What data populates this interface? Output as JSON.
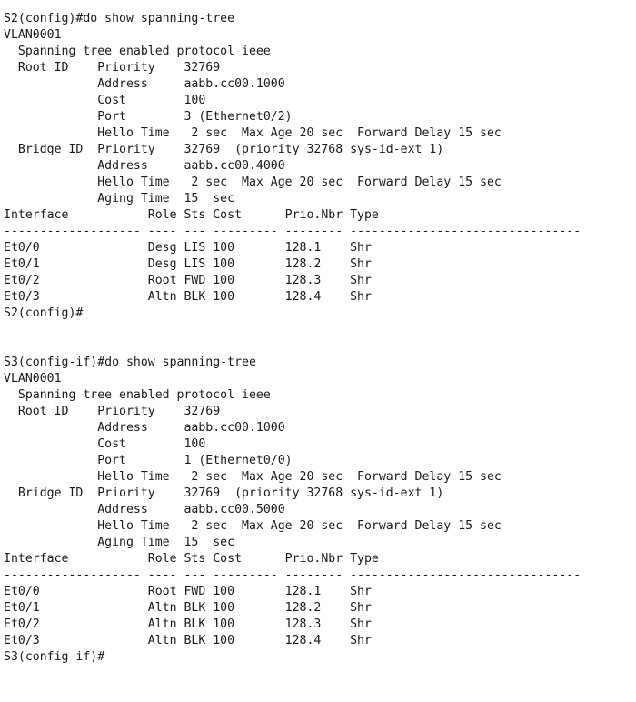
{
  "terminal": {
    "lines": [
      "S2(config)#do show spanning-tree",
      "VLAN0001",
      "  Spanning tree enabled protocol ieee",
      "  Root ID    Priority    32769",
      "             Address     aabb.cc00.1000",
      "             Cost        100",
      "             Port        3 (Ethernet0/2)",
      "             Hello Time   2 sec  Max Age 20 sec  Forward Delay 15 sec",
      "  Bridge ID  Priority    32769  (priority 32768 sys-id-ext 1)",
      "             Address     aabb.cc00.4000",
      "             Hello Time   2 sec  Max Age 20 sec  Forward Delay 15 sec",
      "             Aging Time  15  sec",
      "Interface           Role Sts Cost      Prio.Nbr Type",
      "------------------- ---- --- --------- -------- --------------------------------",
      "Et0/0               Desg LIS 100       128.1    Shr",
      "Et0/1               Desg LIS 100       128.2    Shr",
      "Et0/2               Root FWD 100       128.3    Shr",
      "Et0/3               Altn BLK 100       128.4    Shr",
      "S2(config)#",
      "",
      "",
      "S3(config-if)#do show spanning-tree",
      "VLAN0001",
      "  Spanning tree enabled protocol ieee",
      "  Root ID    Priority    32769",
      "             Address     aabb.cc00.1000",
      "             Cost        100",
      "             Port        1 (Ethernet0/0)",
      "             Hello Time   2 sec  Max Age 20 sec  Forward Delay 15 sec",
      "  Bridge ID  Priority    32769  (priority 32768 sys-id-ext 1)",
      "             Address     aabb.cc00.5000",
      "             Hello Time   2 sec  Max Age 20 sec  Forward Delay 15 sec",
      "             Aging Time  15  sec",
      "Interface           Role Sts Cost      Prio.Nbr Type",
      "------------------- ---- --- --------- -------- --------------------------------",
      "Et0/0               Root FWD 100       128.1    Shr",
      "Et0/1               Altn BLK 100       128.2    Shr",
      "Et0/2               Altn BLK 100       128.3    Shr",
      "Et0/3               Altn BLK 100       128.4    Shr",
      "S3(config-if)#"
    ]
  }
}
